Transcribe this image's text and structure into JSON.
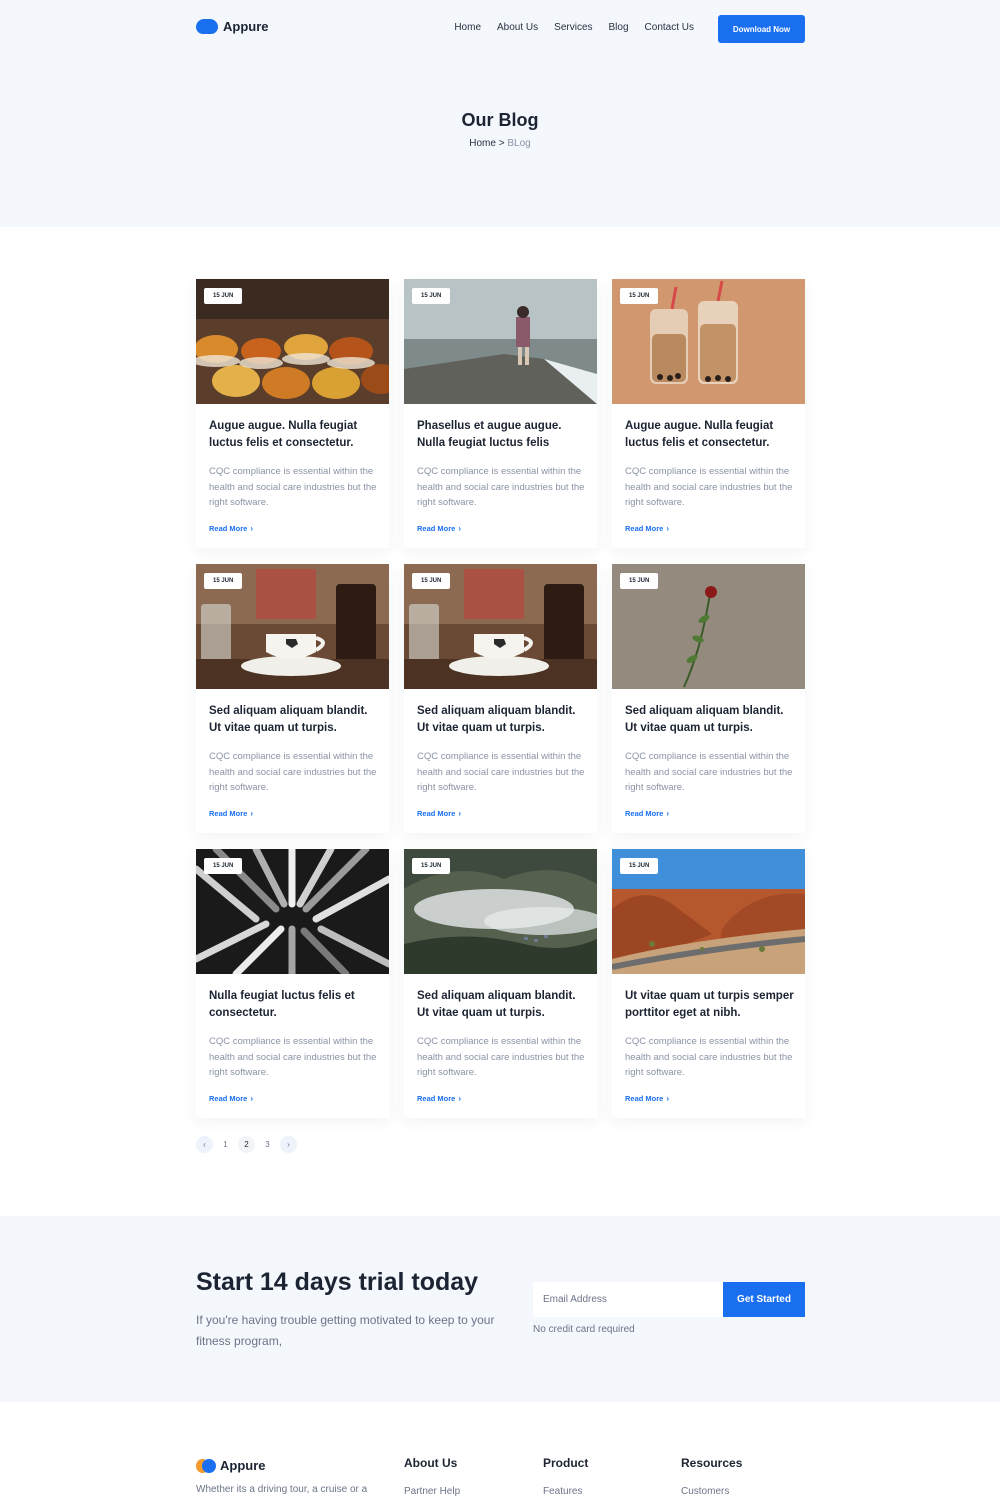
{
  "nav": {
    "brand": "Appure",
    "links": [
      "Home",
      "About Us",
      "Services",
      "Blog",
      "Contact Us"
    ],
    "cta": "Download Now"
  },
  "hero": {
    "title": "Our Blog",
    "breadcrumb_home": "Home",
    "breadcrumb_sep": " > ",
    "breadcrumb_current": "BLog"
  },
  "posts": [
    {
      "date": "15 JUN",
      "title": "Augue augue. Nulla feugiat luctus felis et consectetur.",
      "excerpt": "CQC compliance is essential within the health and social care industries but the right software.",
      "read_more": "Read More",
      "image": "spice-market"
    },
    {
      "date": "15 JUN",
      "title": "Phasellus et augue augue. Nulla feugiat luctus felis",
      "excerpt": "CQC compliance is essential within the health and social care industries but the right software.",
      "read_more": "Read More",
      "image": "woman-on-pier"
    },
    {
      "date": "15 JUN",
      "title": "Augue augue. Nulla feugiat luctus felis et consectetur.",
      "excerpt": "CQC compliance is essential within the health and social care industries but the right software.",
      "read_more": "Read More",
      "image": "bubble-tea"
    },
    {
      "date": "15 JUN",
      "title": "Sed aliquam aliquam blandit. Ut vitae quam ut turpis.",
      "excerpt": "CQC compliance is essential within the health and social care industries but the right software.",
      "read_more": "Read More",
      "image": "coffee-cup"
    },
    {
      "date": "15 JUN",
      "title": "Sed aliquam aliquam blandit. Ut vitae quam ut turpis.",
      "excerpt": "CQC compliance is essential within the health and social care industries but the right software.",
      "read_more": "Read More",
      "image": "coffee-cup"
    },
    {
      "date": "15 JUN",
      "title": "Sed aliquam aliquam blandit. Ut vitae quam ut turpis.",
      "excerpt": "CQC compliance is essential within the health and social care industries but the right software.",
      "read_more": "Read More",
      "image": "rose-on-wall"
    },
    {
      "date": "15 JUN",
      "title": "Nulla feugiat luctus felis et consectetur.",
      "excerpt": "CQC compliance is essential within the health and social care industries but the right software.",
      "read_more": "Read More",
      "image": "abstract-sticks"
    },
    {
      "date": "15 JUN",
      "title": "Sed aliquam aliquam blandit. Ut vitae quam ut turpis.",
      "excerpt": "CQC compliance is essential within the health and social care industries but the right software.",
      "read_more": "Read More",
      "image": "misty-hills"
    },
    {
      "date": "15 JUN",
      "title": "Ut vitae quam ut turpis semper porttitor eget at nibh.",
      "excerpt": "CQC compliance is essential within the health and social care industries but the right software.",
      "read_more": "Read More",
      "image": "desert-road"
    }
  ],
  "pagination": {
    "prev": "‹",
    "pages": [
      "1",
      "2",
      "3"
    ],
    "active": "2",
    "next": "›"
  },
  "cta": {
    "title": "Start 14 days trial today",
    "subtitle": "If you're having trouble getting motivated to keep to your fitness program,",
    "email_placeholder": "Email Address",
    "button": "Get Started",
    "note": "No credit card required"
  },
  "footer": {
    "brand": "Appure",
    "description": "Whether its a driving tour, a cruise or a",
    "columns": [
      {
        "title": "About Us",
        "first_item": "Partner Help"
      },
      {
        "title": "Product",
        "first_item": "Features"
      },
      {
        "title": "Resources",
        "first_item": "Customers"
      }
    ]
  },
  "colors": {
    "accent": "#1a6ff0",
    "hero_bg": "#f4f7fc",
    "muted_text": "#8a93a6",
    "logo_orange": "#f59a2c"
  }
}
